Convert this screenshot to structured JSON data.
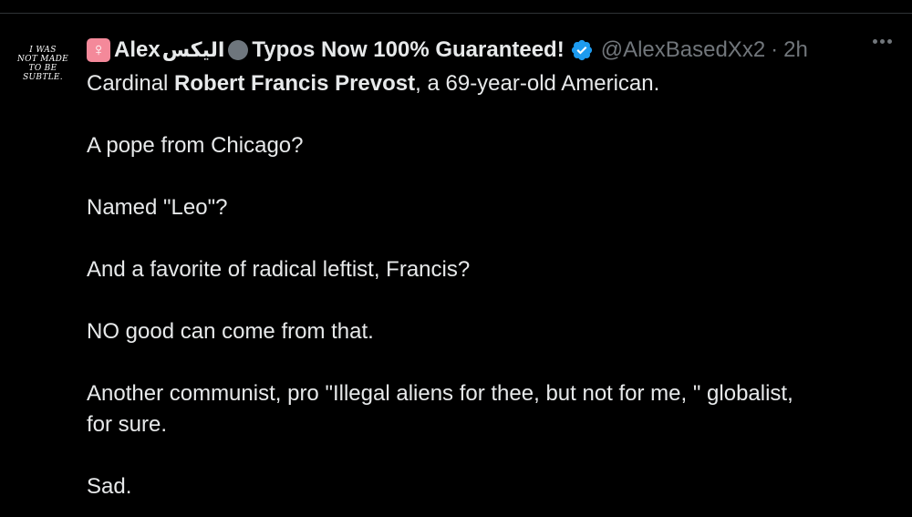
{
  "avatar": {
    "text": "I WAS\nNOT MADE\nTO BE\nSUBTLE."
  },
  "header": {
    "venus_icon": "♀",
    "name_part1": "Alex",
    "name_arabic": "اليكس",
    "name_part2": "Typos Now 100% Guaranteed!",
    "handle": "@AlexBasedXx2",
    "separator": "·",
    "time": "2h",
    "verified_color": "#1d9bf0"
  },
  "tweet": {
    "line1_pre": "Cardinal ",
    "line1_bold": "Robert Francis Prevost",
    "line1_post": ", a 69-year-old American.",
    "p2": "A pope from Chicago?",
    "p3": "Named \"Leo\"?",
    "p4": "And a favorite of radical leftist, Francis?",
    "p5": "NO good can come from that.",
    "p6_line1": "Another communist, pro \"Illegal aliens for thee, but not for me, \" globalist,",
    "p6_line2": "for sure.",
    "p7": "Sad."
  }
}
